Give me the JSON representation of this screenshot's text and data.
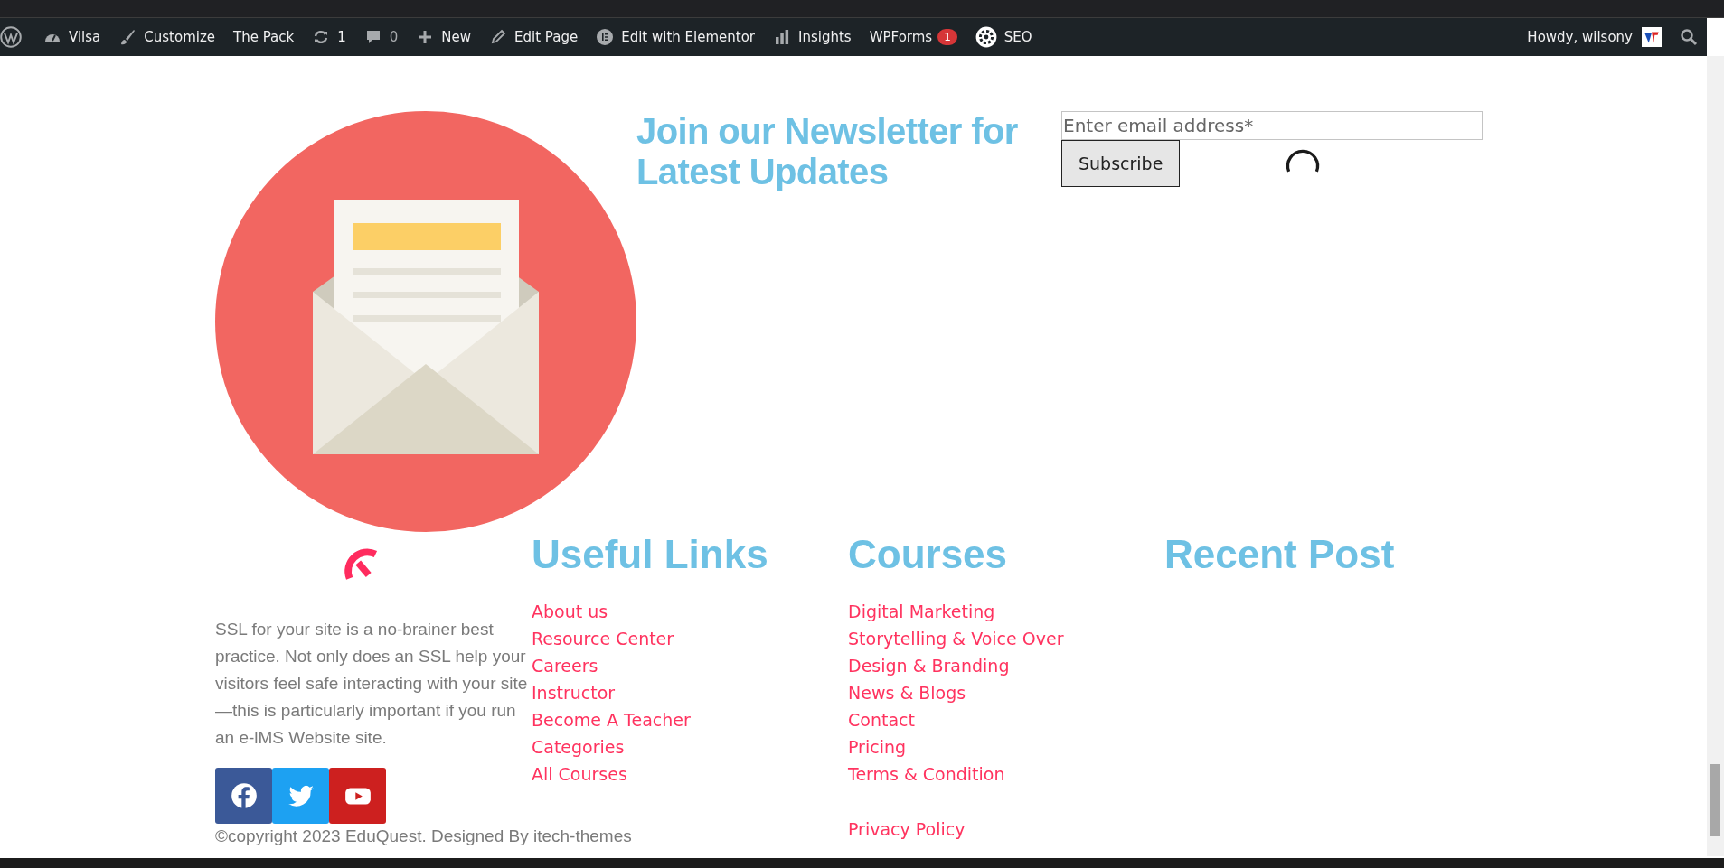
{
  "admin_bar": {
    "items": [
      {
        "kind": "logo"
      },
      {
        "kind": "site",
        "label": "Vilsa"
      },
      {
        "kind": "customize",
        "label": "Customize"
      },
      {
        "kind": "plain",
        "label": "The Pack"
      },
      {
        "kind": "updates",
        "label": "1"
      },
      {
        "kind": "comments",
        "label": "0"
      },
      {
        "kind": "new",
        "label": "New"
      },
      {
        "kind": "edit",
        "label": "Edit Page"
      },
      {
        "kind": "elementor",
        "label": "Edit with Elementor"
      },
      {
        "kind": "insights",
        "label": "Insights"
      },
      {
        "kind": "wpforms",
        "label": "WPForms",
        "badge": "1"
      },
      {
        "kind": "seo",
        "label": "SEO"
      }
    ],
    "greeting": "Howdy, wilsony"
  },
  "newsletter": {
    "heading": "Join our Newsletter for Latest Updates",
    "email_placeholder": "Enter email address*",
    "button": "Subscribe"
  },
  "footer": {
    "about": "SSL for your site is a no-brainer best practice. Not only does an SSL help your visitors feel safe interacting with your site—this is particularly important if you run an e-lMS Website site.",
    "social": [
      {
        "kind": "facebook"
      },
      {
        "kind": "twitter"
      },
      {
        "kind": "youtube"
      }
    ],
    "columns": [
      {
        "heading": "Useful Links",
        "links": [
          "About us",
          "Resource Center",
          "Careers",
          "Instructor",
          "Become A Teacher",
          "Categories",
          "All Courses"
        ]
      },
      {
        "heading": "Courses",
        "links": [
          "Digital Marketing",
          "Storytelling & Voice Over",
          "Design & Branding",
          "News & Blogs",
          "Contact",
          "Pricing",
          "Terms & Condition"
        ]
      },
      {
        "heading": "Recent Post"
      }
    ],
    "copyright": "©copyright 2023 EduQuest. Designed By itech-themes",
    "bottom_link": "Privacy Policy"
  }
}
